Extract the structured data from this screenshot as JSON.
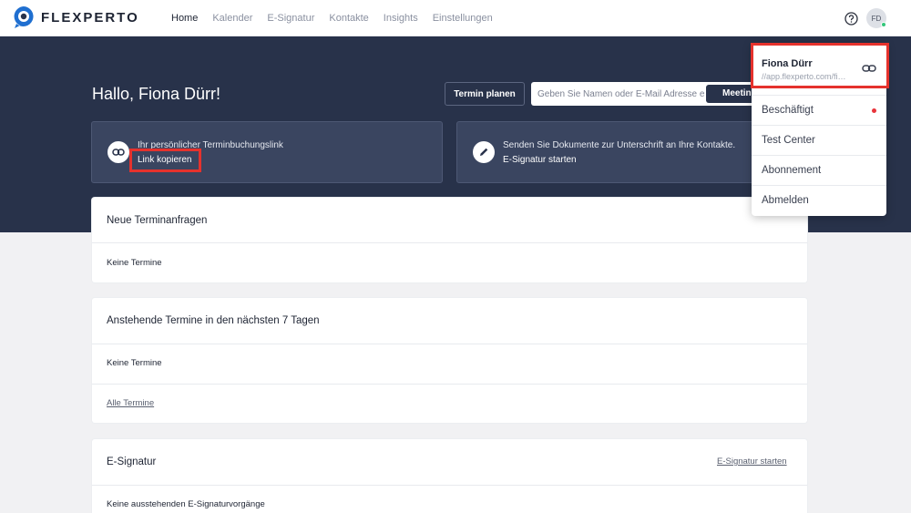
{
  "app": {
    "brand": "FLEXPERTO"
  },
  "nav": {
    "items": [
      {
        "label": "Home",
        "active": true
      },
      {
        "label": "Kalender"
      },
      {
        "label": "E-Signatur"
      },
      {
        "label": "Kontakte"
      },
      {
        "label": "Insights"
      },
      {
        "label": "Einstellungen"
      }
    ],
    "avatar_initials": "FD"
  },
  "hero": {
    "greeting": "Hallo, Fiona Dürr!",
    "termin_button": "Termin planen",
    "search_placeholder": "Geben Sie Namen oder E-Mail Adresse ein",
    "meeting_button": "Meeting"
  },
  "cards": {
    "booking": {
      "title": "Ihr persönlicher Terminbuchungslink",
      "link": "Link kopieren"
    },
    "esign": {
      "title": "Senden Sie Dokumente zur Unterschrift an Ihre Kontakte.",
      "link": "E-Signatur starten"
    }
  },
  "panels": {
    "requests": {
      "title": "Neue Terminanfragen",
      "empty": "Keine Termine"
    },
    "upcoming": {
      "title": "Anstehende Termine in den nächsten 7 Tagen",
      "empty": "Keine Termine",
      "all_link": "Alle Termine"
    },
    "esignatur": {
      "title": "E-Signatur",
      "start_link": "E-Signatur starten",
      "empty": "Keine ausstehenden E-Signaturvorgänge"
    }
  },
  "dropdown": {
    "name": "Fiona Dürr",
    "url": "//app.flexperto.com/fiona-duerr",
    "items": [
      {
        "label": "Beschäftigt"
      },
      {
        "label": "Test Center"
      },
      {
        "label": "Abonnement"
      },
      {
        "label": "Abmelden"
      }
    ]
  },
  "colors": {
    "brand_dark": "#28324a",
    "highlight": "#e5322d",
    "status_busy": "#e8343b",
    "online": "#34c77b"
  }
}
